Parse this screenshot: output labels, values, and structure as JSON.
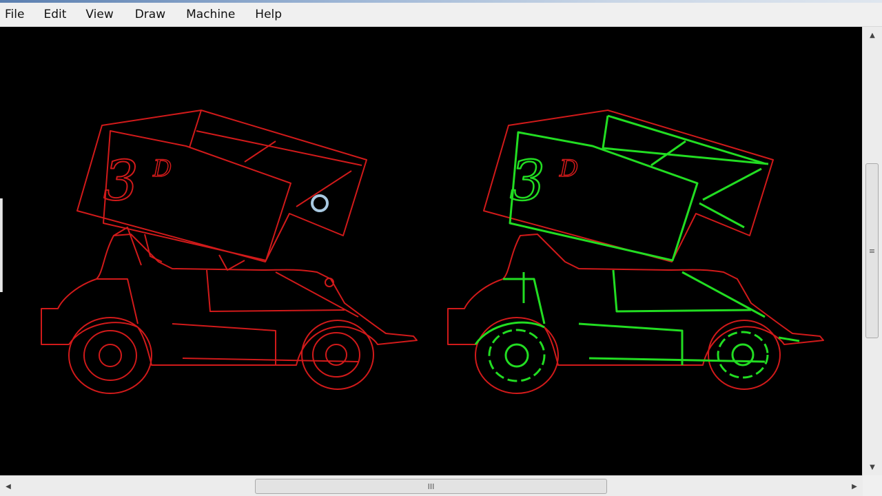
{
  "menubar": {
    "items": [
      {
        "label": "File"
      },
      {
        "label": "Edit"
      },
      {
        "label": "View"
      },
      {
        "label": "Draw"
      },
      {
        "label": "Machine"
      },
      {
        "label": "Help"
      }
    ]
  },
  "canvas": {
    "background": "#000000",
    "left_drawing": {
      "text": "3",
      "superscript": "D",
      "outline_color": "#d11a1a"
    },
    "right_drawing": {
      "text": "3",
      "superscript": "D",
      "outline_color": "#d11a1a",
      "toolpath_color": "#22dd22"
    }
  },
  "scrollbars": {
    "vertical_grip": "≡",
    "horizontal_grip": "III"
  }
}
